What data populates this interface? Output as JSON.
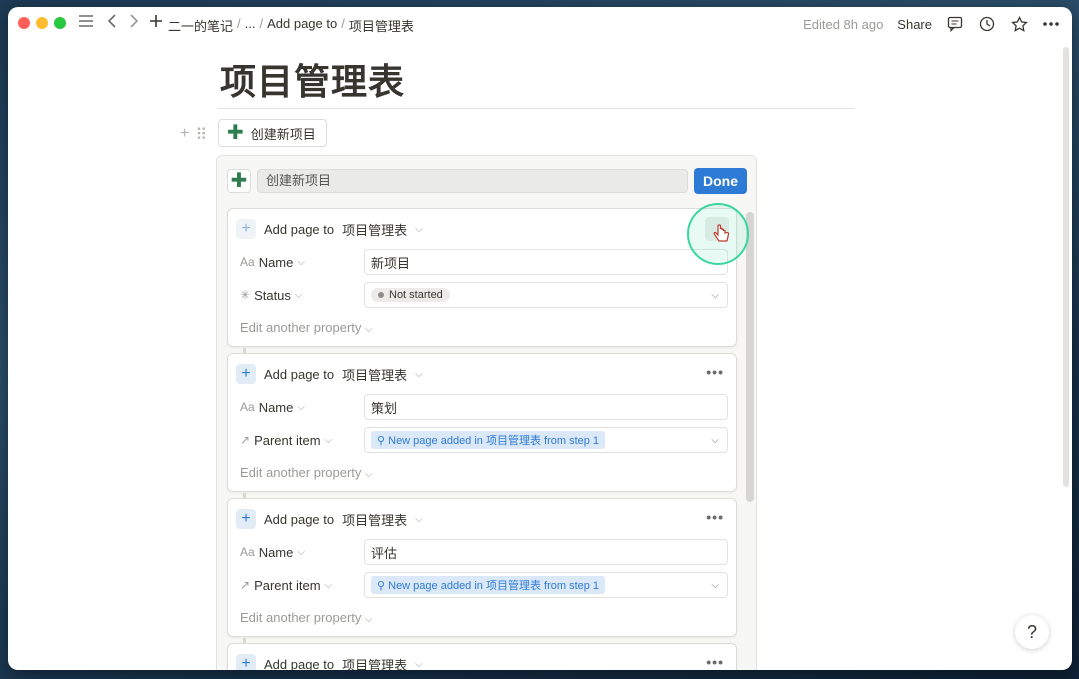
{
  "topbar": {
    "breadcrumbs": [
      "二一的笔记",
      "...",
      "Add page to",
      "项目管理表"
    ],
    "edited": "Edited 8h ago",
    "share": "Share",
    "icons": [
      "menu-icon",
      "back-icon",
      "forward-icon",
      "new-page-icon",
      "comment-icon",
      "history-icon",
      "star-icon",
      "more-icon"
    ]
  },
  "page": {
    "title": "项目管理表",
    "button_label": "创建新项目"
  },
  "panel": {
    "input_value": "创建新项目",
    "done_label": "Done",
    "steps": [
      {
        "action": "Add page to",
        "target": "项目管理表",
        "props": [
          {
            "label": "Name",
            "icon": "text-icon",
            "value": "新项目"
          },
          {
            "label": "Status",
            "icon": "status-icon",
            "value": "Not started"
          }
        ],
        "edit_another": "Edit another property"
      },
      {
        "action": "Add page to",
        "target": "项目管理表",
        "props": [
          {
            "label": "Name",
            "icon": "text-icon",
            "value": "策划"
          },
          {
            "label": "Parent item",
            "icon": "relation-icon",
            "value": "New page added in 项目管理表 from step 1"
          }
        ],
        "edit_another": "Edit another property"
      },
      {
        "action": "Add page to",
        "target": "项目管理表",
        "props": [
          {
            "label": "Name",
            "icon": "text-icon",
            "value": "评估"
          },
          {
            "label": "Parent item",
            "icon": "relation-icon",
            "value": "New page added in 项目管理表 from step 1"
          }
        ],
        "edit_another": "Edit another property"
      },
      {
        "action": "Add page to",
        "target": "项目管理表"
      }
    ]
  },
  "help_label": "?",
  "colors": {
    "accent": "#2e7bd6",
    "plus_green": "#2e7d4f",
    "cursor_ring": "#3ad6a0"
  }
}
